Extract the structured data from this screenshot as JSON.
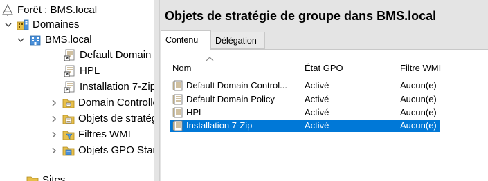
{
  "tree": {
    "items": [
      {
        "label": "Forêt : BMS.local",
        "icon": "forest-icon",
        "expander": ""
      },
      {
        "label": "Domaines",
        "icon": "domains-icon",
        "expander": "expanded"
      },
      {
        "label": "BMS.local",
        "icon": "domain-icon",
        "expander": "expanded"
      },
      {
        "label": "Default Domain Policy",
        "icon": "gpo-link-icon",
        "expander": ""
      },
      {
        "label": "HPL",
        "icon": "gpo-link-icon",
        "expander": ""
      },
      {
        "label": "Installation 7-Zip",
        "icon": "gpo-link-icon",
        "expander": ""
      },
      {
        "label": "Domain Controllers",
        "icon": "ou-folder-icon",
        "expander": "collapsed"
      },
      {
        "label": "Objets de stratégie de groupe",
        "icon": "gpo-container-icon",
        "expander": "collapsed"
      },
      {
        "label": "Filtres WMI",
        "icon": "wmi-filter-folder-icon",
        "expander": "collapsed"
      },
      {
        "label": "Objets GPO Starter",
        "icon": "starter-gpo-folder-icon",
        "expander": "collapsed"
      },
      {
        "label": "Sites",
        "icon": "sites-icon",
        "expander": ""
      }
    ]
  },
  "content": {
    "title": "Objets de stratégie de groupe dans BMS.local",
    "tabs": [
      {
        "label": "Contenu",
        "active": true
      },
      {
        "label": "Délégation",
        "active": false
      }
    ],
    "columns": [
      "Nom",
      "État GPO",
      "Filtre WMI"
    ],
    "rows": [
      {
        "name": "Default Domain Control...",
        "state": "Activé",
        "wmi": "Aucun(e)",
        "selected": false
      },
      {
        "name": "Default Domain Policy",
        "state": "Activé",
        "wmi": "Aucun(e)",
        "selected": false
      },
      {
        "name": "HPL",
        "state": "Activé",
        "wmi": "Aucun(e)",
        "selected": false
      },
      {
        "name": "Installation 7-Zip",
        "state": "Activé",
        "wmi": "Aucun(e)",
        "selected": true
      }
    ]
  },
  "colors": {
    "selection": "#0078d7",
    "pane_background": "#e4e4e4",
    "folder_yellow": "#e8c04a"
  }
}
